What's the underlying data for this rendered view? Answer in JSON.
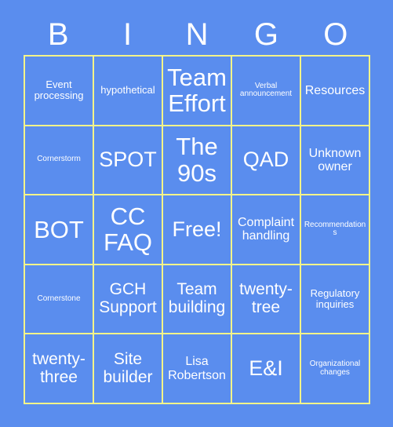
{
  "card": {
    "title": "BINGO",
    "background_color": "#5a8dee",
    "grid_line_color": "#f4f489",
    "text_color": "#ffffff"
  },
  "header": {
    "letters": [
      {
        "label": "B"
      },
      {
        "label": "I"
      },
      {
        "label": "N"
      },
      {
        "label": "G"
      },
      {
        "label": "O"
      }
    ]
  },
  "grid": {
    "rows": [
      {
        "cells": [
          {
            "label": "Event processing",
            "size": "s"
          },
          {
            "label": "hypothetical",
            "size": "s"
          },
          {
            "label": "Team Effort",
            "size": "xxl"
          },
          {
            "label": "Verbal announcement",
            "size": "xs"
          },
          {
            "label": "Resources",
            "size": "m"
          }
        ]
      },
      {
        "cells": [
          {
            "label": "Cornerstorm",
            "size": "xs"
          },
          {
            "label": "SPOT",
            "size": "xl"
          },
          {
            "label": "The 90s",
            "size": "xxl"
          },
          {
            "label": "QAD",
            "size": "xl"
          },
          {
            "label": "Unknown owner",
            "size": "m"
          }
        ]
      },
      {
        "cells": [
          {
            "label": "BOT",
            "size": "xxl"
          },
          {
            "label": "CC FAQ",
            "size": "xxl"
          },
          {
            "label": "Free!",
            "size": "xl"
          },
          {
            "label": "Complaint handling",
            "size": "m"
          },
          {
            "label": "Recommendations",
            "size": "xs"
          }
        ]
      },
      {
        "cells": [
          {
            "label": "Cornerstone",
            "size": "xs"
          },
          {
            "label": "GCH Support",
            "size": "l"
          },
          {
            "label": "Team building",
            "size": "l"
          },
          {
            "label": "twenty-tree",
            "size": "l"
          },
          {
            "label": "Regulatory inquiries",
            "size": "s"
          }
        ]
      },
      {
        "cells": [
          {
            "label": "twenty-three",
            "size": "l"
          },
          {
            "label": "Site builder",
            "size": "l"
          },
          {
            "label": "Lisa Robertson",
            "size": "m"
          },
          {
            "label": "E&I",
            "size": "xl"
          },
          {
            "label": "Organizational changes",
            "size": "xs"
          }
        ]
      }
    ]
  }
}
